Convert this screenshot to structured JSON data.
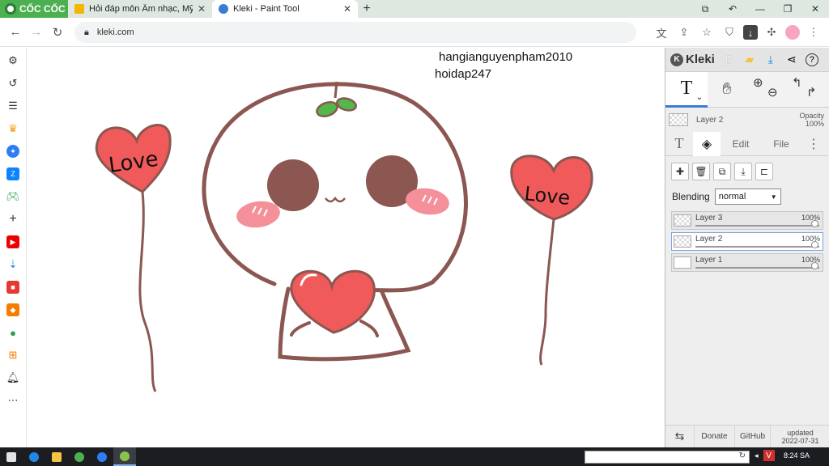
{
  "browser": {
    "brand": "CỐC CỐC",
    "tabs": [
      {
        "title": "Hỏi đáp môn Âm nhạc, Mỹ th"
      },
      {
        "title": "Kleki - Paint Tool"
      }
    ],
    "url": "kleki.com"
  },
  "canvas": {
    "credit_line1": "hangianguyenpham2010",
    "credit_line2": "hoidap247",
    "balloon_left_text": "Love",
    "balloon_right_text": "Love"
  },
  "kleki": {
    "logo": "Kleki",
    "active_tool": "T",
    "current_layer": "Layer 2",
    "opacity_label": "Opacity",
    "opacity_value": "100%",
    "tabs": {
      "text": "T",
      "edit": "Edit",
      "file": "File",
      "more": "⋮"
    },
    "blending_label": "Blending",
    "blending_value": "normal",
    "layers": [
      {
        "name": "Layer 3",
        "opacity": "100%",
        "selected": false
      },
      {
        "name": "Layer 2",
        "opacity": "100%",
        "selected": true
      },
      {
        "name": "Layer 1",
        "opacity": "100%",
        "selected": false
      }
    ],
    "footer": {
      "donate": "Donate",
      "github": "GitHub",
      "updated_label": "updated",
      "updated_date": "2022-07-31"
    }
  },
  "taskbar": {
    "time": "8:24 SA",
    "tray_v": "V"
  },
  "colors": {
    "accent": "#3b7bd4",
    "outline": "#8b5750",
    "heart": "#f05a5a",
    "leaf": "#52b84a",
    "brand_green": "#4caf50"
  }
}
